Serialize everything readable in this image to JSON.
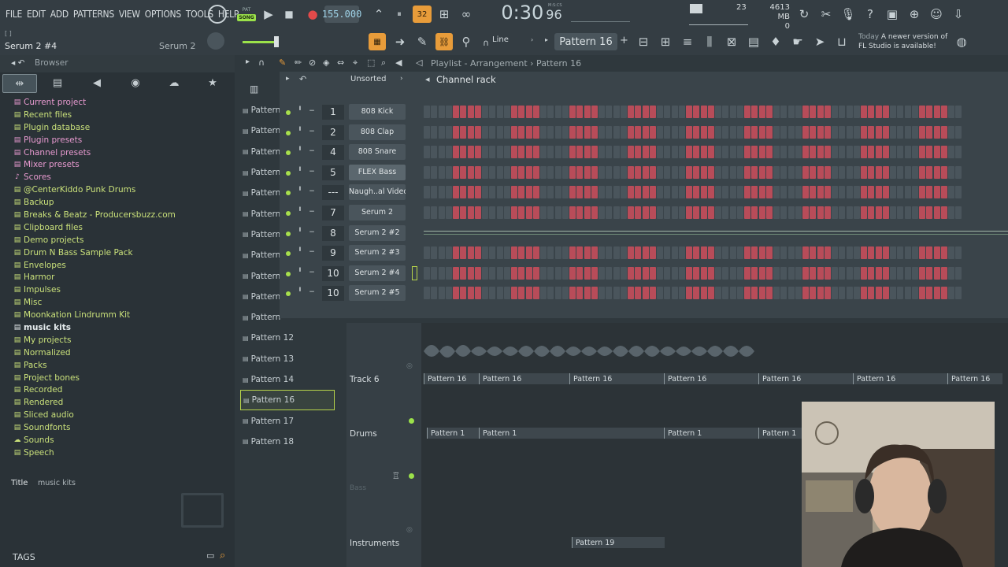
{
  "menu": [
    "FILE",
    "EDIT",
    "ADD",
    "PATTERNS",
    "VIEW",
    "OPTIONS",
    "TOOLS",
    "HELP"
  ],
  "transport": {
    "pat_label": "PAT",
    "song_label": "SONG",
    "tempo": "155.000",
    "time_main": "0:30",
    "time_sub": "96",
    "time_unit": "M:S:CS"
  },
  "memory": {
    "ram": "4613 MB",
    "cpu": "0",
    "voices": "23"
  },
  "hint": {
    "channel": "Serum 2 #4",
    "instrument": "Serum 2",
    "bracket": "[ ]"
  },
  "toolbar": {
    "snap": "Line",
    "pattern": "Pattern 16"
  },
  "news": {
    "date": "Today",
    "text": "A newer version of FL Studio is available!"
  },
  "browser": {
    "title": "Browser",
    "items": [
      {
        "label": "Current project",
        "style": "pink",
        "icon": "folder-icon"
      },
      {
        "label": "Recent files",
        "style": "green",
        "icon": "folder-icon"
      },
      {
        "label": "Plugin database",
        "style": "green",
        "icon": "folder-icon"
      },
      {
        "label": "Plugin presets",
        "style": "pink",
        "icon": "folder-icon"
      },
      {
        "label": "Channel presets",
        "style": "pink",
        "icon": "folder-icon"
      },
      {
        "label": "Mixer presets",
        "style": "pink",
        "icon": "folder-icon"
      },
      {
        "label": "Scores",
        "style": "pink",
        "icon": "note-icon"
      },
      {
        "label": "@CenterKiddo Punk Drums",
        "style": "green",
        "icon": "folder-icon"
      },
      {
        "label": "Backup",
        "style": "green",
        "icon": "folder-icon"
      },
      {
        "label": "Breaks & Beatz - Producersbuzz.com",
        "style": "green",
        "icon": "folder-icon"
      },
      {
        "label": "Clipboard files",
        "style": "green",
        "icon": "folder-icon"
      },
      {
        "label": "Demo projects",
        "style": "green",
        "icon": "folder-icon"
      },
      {
        "label": "Drum N Bass Sample Pack",
        "style": "green",
        "icon": "folder-icon"
      },
      {
        "label": "Envelopes",
        "style": "green",
        "icon": "folder-icon"
      },
      {
        "label": "Harmor",
        "style": "green",
        "icon": "folder-icon"
      },
      {
        "label": "Impulses",
        "style": "green",
        "icon": "folder-icon"
      },
      {
        "label": "Misc",
        "style": "green",
        "icon": "folder-icon"
      },
      {
        "label": "Moonkation Lindrumm Kit",
        "style": "green",
        "icon": "folder-icon"
      },
      {
        "label": "music kits",
        "style": "white",
        "icon": "folder-open-icon"
      },
      {
        "label": "My projects",
        "style": "green",
        "icon": "folder-icon"
      },
      {
        "label": "Normalized",
        "style": "green",
        "icon": "folder-icon"
      },
      {
        "label": "Packs",
        "style": "green",
        "icon": "folder-icon"
      },
      {
        "label": "Project bones",
        "style": "green",
        "icon": "folder-icon"
      },
      {
        "label": "Recorded",
        "style": "green",
        "icon": "folder-icon"
      },
      {
        "label": "Rendered",
        "style": "green",
        "icon": "folder-icon"
      },
      {
        "label": "Sliced audio",
        "style": "green",
        "icon": "folder-icon"
      },
      {
        "label": "Soundfonts",
        "style": "green",
        "icon": "folder-icon"
      },
      {
        "label": "Sounds",
        "style": "green",
        "icon": "cloud-icon"
      },
      {
        "label": "Speech",
        "style": "green",
        "icon": "folder-icon"
      }
    ],
    "title_label": "Title",
    "title_value": "music kits",
    "tags_label": "TAGS"
  },
  "patterns": [
    "Pattern",
    "Pattern",
    "Pattern",
    "Pattern",
    "Pattern",
    "Pattern",
    "Pattern",
    "Pattern",
    "Pattern",
    "Pattern",
    "Pattern",
    "Pattern 12",
    "Pattern 13",
    "Pattern 14",
    "Pattern 16",
    "Pattern 17",
    "Pattern 18"
  ],
  "selected_pattern_index": 14,
  "breadcrumb": "Playlist - Arrangement › Pattern 16",
  "channel_rack": {
    "title": "Channel rack",
    "sort": "Unsorted",
    "channels": [
      {
        "num": "1",
        "name": "808 Kick",
        "steps": "ssssrrrrssssrrrrssssrrrrssssrrrrssssrrrrssssrrrrssssrrrrssssrrrrssssrrrrss"
      },
      {
        "num": "2",
        "name": "808 Clap",
        "steps": "ssssrrrrssssrrrrssssrrrrssssrrrrssssrrrrssssrrrrssssrrrrssssrrrrssssrrrrss"
      },
      {
        "num": "4",
        "name": "808 Snare",
        "steps": "ssssrrrrssssrrrrssssrrrrssssrrrrssssrrrrssssrrrrssssrrrrssssrrrrssssrrrrss"
      },
      {
        "num": "5",
        "name": "FLEX Bass",
        "steps": "ssssrrrrssssrrrrssssrrrrssssrrrrssssrrrrssssrrrrssssrrrrssssrrrrssssrrrrss",
        "hl": true
      },
      {
        "num": "---",
        "name": "Naugh..al Video)",
        "steps": "ssssrrrrssssrrrrssssrrrrssssrrrrssssrrrrssssrrrrssssrrrrssssrrrrssssrrrrss"
      },
      {
        "num": "7",
        "name": "Serum 2",
        "steps": "ssssrrrrssssrrrrssssrrrrssssrrrrssssrrrrssssrrrrssssrrrrssssrrrrssssrrrrss"
      },
      {
        "num": "8",
        "name": "Serum 2 #2",
        "steps": "roll"
      },
      {
        "num": "9",
        "name": "Serum 2 #3",
        "steps": "ssssrrrrssssrrrrssssrrrrssssrrrrssssrrrrssssrrrrssssrrrrssssrrrrssssrrrrss"
      },
      {
        "num": "10",
        "name": "Serum 2 #4",
        "steps": "ssssrrrrssssrrrrssssrrrrssssrrrrssssrrrrssssrrrrssssrrrrssssrrrrssssrrrrss"
      },
      {
        "num": "10",
        "name": "Serum 2 #5",
        "steps": "ssssrrrrssssrrrrssssrrrrssssrrrrssssrrrrssssrrrrssssrrrrssssrrrrssssrrrrss"
      }
    ],
    "add_label": "+"
  },
  "playlist": {
    "tracks": [
      {
        "name": "Track 6"
      },
      {
        "name": "Drums"
      },
      {
        "name": "Bass"
      },
      {
        "name": "Instruments"
      }
    ],
    "clips_track6": [
      "Pattern 16",
      "Pattern 16",
      "Pattern 16",
      "Pattern 16",
      "Pattern 16",
      "Pattern 16",
      "Pattern 16"
    ],
    "clips_drums": [
      "Pattern 1",
      "Pattern 1",
      "Pattern 1",
      "Pattern 1"
    ],
    "clip_instr": "Pattern 19"
  },
  "colors": {
    "accent_green": "#9be24a",
    "step_red": "#b84c59",
    "step_off": "#4a555c",
    "orange": "#e89c3a"
  }
}
